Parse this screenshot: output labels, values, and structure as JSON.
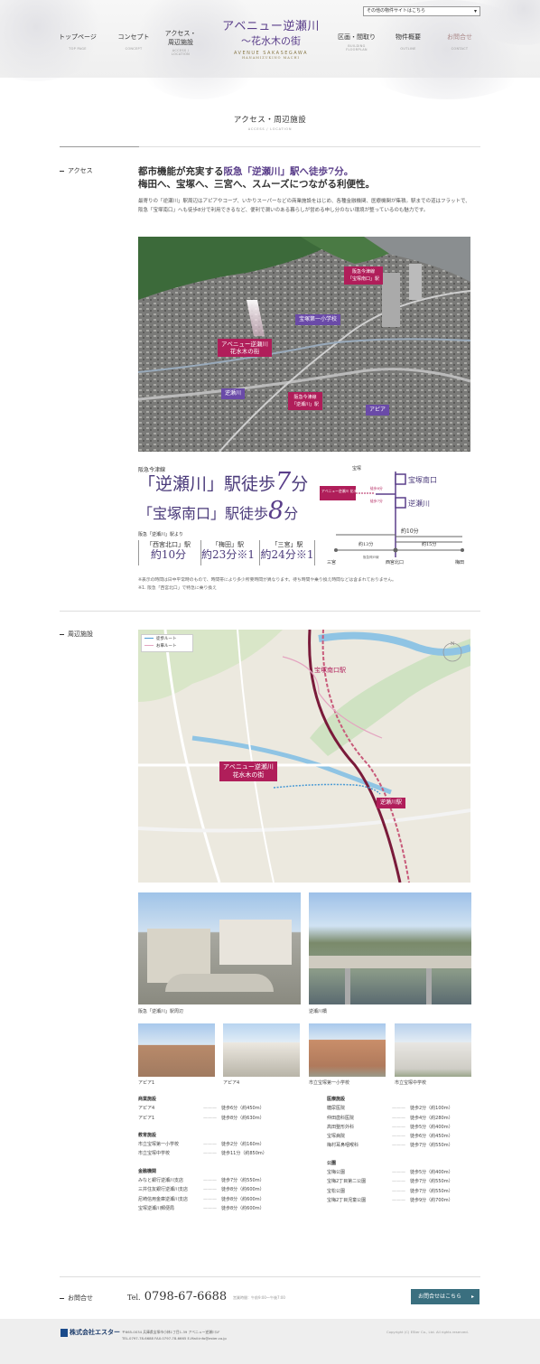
{
  "header": {
    "other_sites_select": "その他の物件サイトはこちら",
    "nav_left": [
      {
        "jp": "トップページ",
        "en": "TOP PAGE"
      },
      {
        "jp": "コンセプト",
        "en": "CONCEPT"
      },
      {
        "jp": "アクセス・\n周辺施設",
        "en": "ACCESS /\nLOCATION"
      }
    ],
    "nav_right": [
      {
        "jp": "区画・間取り",
        "en": "BUILDING\nFLOORPLAN"
      },
      {
        "jp": "物件概要",
        "en": "OUTLINE"
      },
      {
        "jp": "お問合せ",
        "en": "CONTACT"
      }
    ],
    "logo": {
      "l1": "アベニュー逆瀬川",
      "l2": "〜花水木の街",
      "l3": "AVENUE SAKASEGAWA",
      "l4": "HANAMIZUKINO MACHI"
    }
  },
  "page_title": {
    "jp": "アクセス・周辺施設",
    "en": "ACCESS / LOCATION"
  },
  "access": {
    "label": "アクセス",
    "lead_1a": "都市機能が充実する",
    "lead_1b": "阪急「逆瀬川」駅へ徒歩7分。",
    "lead_2": "梅田へ、宝塚へ、三宮へ、スムーズにつながる利便性。",
    "body": "最寄りの「逆瀬川」駅周辺はアピアやコープ、いかりスーパーなどの商業施設をはじめ、各種金融機関、医療機関が集積。駅までの道はフラットで、阪急「宝塚南口」へも徒歩8分で利用できるなど、便利で潤いのある暮らしが営める申し分のない環境が整っているのも魅力です。",
    "aerial_tags": {
      "site": "アベニュー逆瀬川\n花水木の街",
      "takarazuka_minamiguchi": "阪急今津線\n「宝塚南口」駅",
      "sakasegawa_st": "阪急今津線\n「逆瀬川」駅",
      "school": "宝塚第一小学校",
      "river": "逆瀬川",
      "appia": "アピア"
    },
    "line_name": "阪急今津線",
    "walk_sakasegawa_pre": "「逆瀬川」駅徒歩",
    "walk_sakasegawa_min": "7",
    "walk_sakasegawa_post": "分",
    "walk_minamiguchi_pre": "「宝塚南口」駅徒歩",
    "walk_minamiguchi_min": "8",
    "walk_minamiguchi_post": "分",
    "sub": "阪急「逆瀬川」駅より",
    "times": [
      {
        "st": "「西宮北口」駅",
        "t": "約10分"
      },
      {
        "st": "「梅田」駅",
        "t": "約23分※1"
      },
      {
        "st": "「三宮」駅",
        "t": "約24分※1"
      }
    ],
    "route": {
      "takarazuka": "宝塚",
      "minamiguchi": "宝塚南口",
      "sakasegawa": "逆瀬川",
      "site": "アベニュー逆瀬川\n花水木の街",
      "w8": "徒歩8分",
      "w7": "徒歩7分",
      "nishinomiya": "西宮北口",
      "sannomiya": "三宮",
      "umeda": "梅田",
      "t10": "約10分",
      "t13": "約13分",
      "t15": "約15分",
      "t13note": "(特急利用)",
      "t15note": "(特急利用)",
      "line_note": "阪急神戸線"
    },
    "note1": "※表示の時間は日中平常時のもので、時間帯により多少所要時間が異なります。待ち時間や乗り換え時間などは含まれておりません。",
    "note2": "※1. 阪急「西宮北口」で特急に乗り換え"
  },
  "nearby": {
    "label": "周辺施設",
    "legend": [
      "徒歩ルート",
      "お車ルート"
    ],
    "map_site": "アベニュー逆瀬川\n花水木の街",
    "map_station": "逆瀬川駅",
    "map_station2": "宝塚南口駅",
    "photos": [
      {
        "cap": "阪急「逆瀬川」駅周辺"
      },
      {
        "cap": "逆瀬川橋"
      },
      {
        "cap": "アピア1"
      },
      {
        "cap": "アピア4"
      },
      {
        "cap": "市立宝塚第一小学校"
      },
      {
        "cap": "市立宝塚中学校"
      }
    ],
    "left_groups": [
      {
        "h": "商業施設",
        "items": [
          [
            "アピア4",
            "徒歩6分（約450m）"
          ],
          [
            "アピア1",
            "徒歩8分（約630m）"
          ]
        ]
      },
      {
        "h": "教育施設",
        "items": [
          [
            "市立宝塚第一小学校",
            "徒歩2分（約160m）"
          ],
          [
            "市立宝塚中学校",
            "徒歩11分（約850m）"
          ]
        ]
      },
      {
        "h": "金融機関",
        "items": [
          [
            "みなと銀行逆瀬川支店",
            "徒歩7分（約550m）"
          ],
          [
            "三井住友銀行逆瀬川支店",
            "徒歩8分（約600m）"
          ],
          [
            "尼崎信用金庫逆瀬川支店",
            "徒歩8分（約600m）"
          ],
          [
            "宝塚逆瀬川郵便局",
            "徒歩8分（約600m）"
          ]
        ]
      }
    ],
    "right_groups": [
      {
        "h": "医療施設",
        "items": [
          [
            "糖尿医院",
            "徒歩2分（約100m）"
          ],
          [
            "仲田歯科医院",
            "徒歩4分（約280m）"
          ],
          [
            "高田整形外科",
            "徒歩5分（約400m）"
          ],
          [
            "宝塚病院",
            "徒歩6分（約450m）"
          ],
          [
            "梅村耳鼻咽喉科",
            "徒歩7分（約550m）"
          ]
        ]
      },
      {
        "h": "公園",
        "items": [
          [
            "宝梅公園",
            "徒歩5分（約400m）"
          ],
          [
            "宝梅2丁目第二公園",
            "徒歩7分（約550m）"
          ],
          [
            "宝松公園",
            "徒歩7分（約550m）"
          ],
          [
            "宝梅2丁目児童公園",
            "徒歩9分（約700m）"
          ]
        ]
      }
    ]
  },
  "contact": {
    "label": "お問合せ",
    "tel_prefix": "Tel.",
    "tel": "0798-67-6688",
    "hours": "営業時間：午前9:00〜午後7:00",
    "button": "お問合せはこちら"
  },
  "footer": {
    "company": "株式会社エスター",
    "address": "〒665-0034 兵庫県宝塚市小林1丁目1-39 アベニュー逆瀬川1F",
    "tel_fax": "TEL.0797-78-6688 FAX.0797-78-6665 E-Mail:info@ester.co.jp",
    "copyright": "Copyright (C) ESter Co., Ltd. All rights reserved."
  },
  "colors": {
    "purple": "#5a3e8a",
    "magenta": "#b01e5a",
    "teal": "#3a6f7f"
  }
}
